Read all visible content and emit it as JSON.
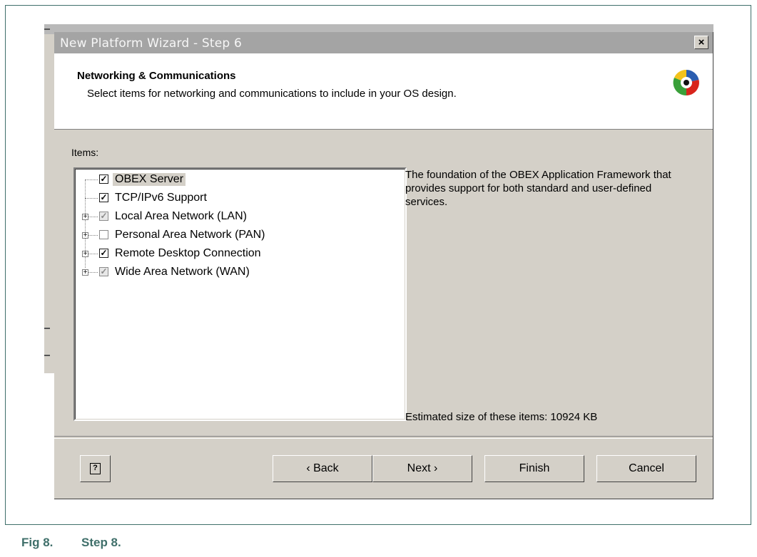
{
  "dialog": {
    "title": "New Platform Wizard - Step 6",
    "close_label": "×",
    "header_title": "Networking & Communications",
    "header_subtitle": "Select items for networking and communications to include in your OS design.",
    "logo_icon": "wizard-logo-icon"
  },
  "items_label": "Items:",
  "tree": {
    "items": [
      {
        "label": "OBEX Server",
        "checked": true,
        "state": "checked",
        "expandable": false,
        "selected": true
      },
      {
        "label": "TCP/IPv6 Support",
        "checked": true,
        "state": "checked",
        "expandable": false,
        "selected": false
      },
      {
        "label": "Local Area Network (LAN)",
        "checked": true,
        "state": "grey-checked",
        "expandable": true,
        "selected": false
      },
      {
        "label": "Personal Area Network (PAN)",
        "checked": false,
        "state": "unchecked",
        "expandable": true,
        "selected": false
      },
      {
        "label": "Remote Desktop Connection",
        "checked": true,
        "state": "checked",
        "expandable": true,
        "selected": false
      },
      {
        "label": "Wide Area Network (WAN)",
        "checked": true,
        "state": "grey-checked",
        "expandable": true,
        "selected": false
      }
    ]
  },
  "description": "The foundation of the OBEX Application Framework that provides support for both standard and user-defined services.",
  "size_text": "Estimated size of these items: 10924 KB",
  "buttons": {
    "help": "?",
    "back": "‹ Back",
    "next": "Next ›",
    "finish": "Finish",
    "cancel": "Cancel"
  },
  "caption": {
    "fig": "Fig 8.",
    "text": "Step 8."
  },
  "colors": {
    "caption": "#3f6f6a",
    "dialog_bg": "#d4d0c8",
    "titlebar": "#a4a4a4"
  }
}
